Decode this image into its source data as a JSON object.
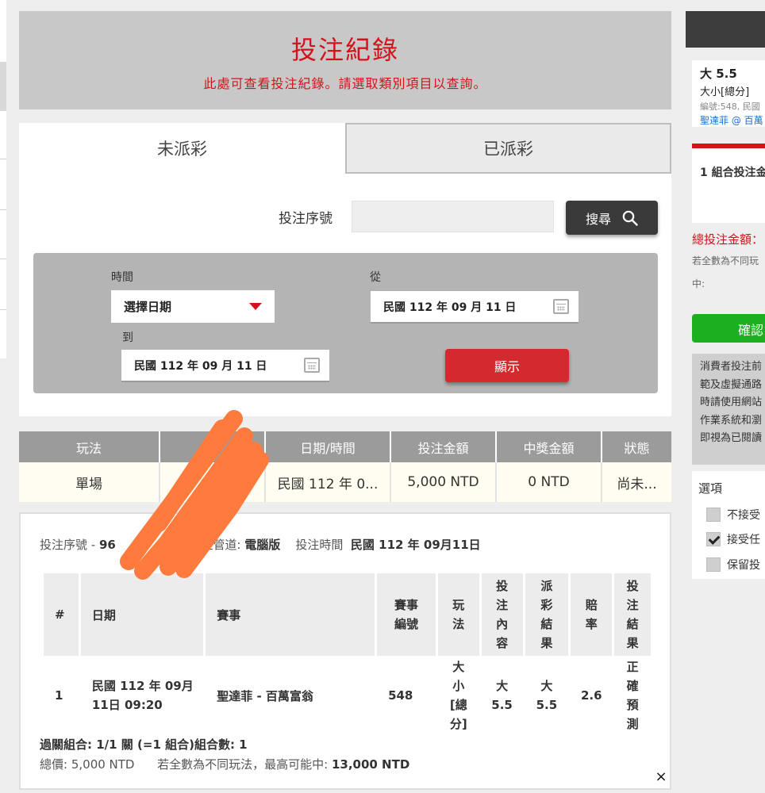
{
  "header": {
    "title": "投注紀錄",
    "subtitle": "此處可查看投注紀錄。請選取類別項目以查詢。"
  },
  "tabs": [
    {
      "label": "未派彩",
      "active": true
    },
    {
      "label": "已派彩",
      "active": false
    }
  ],
  "search": {
    "label": "投注序號",
    "value": "",
    "button_label": "搜尋"
  },
  "filter": {
    "time_label": "時間",
    "time_select_value": "選擇日期",
    "from_label": "從",
    "from_date": "民國 112 年 09 月 11 日",
    "to_label": "到",
    "to_date": "民國 112 年 09 月 11 日",
    "show_button_label": "顯示"
  },
  "results": {
    "headers": [
      "玩法",
      "投",
      "日期/時間",
      "投注金額",
      "中獎金額",
      "狀態"
    ],
    "rows": [
      [
        "單場",
        "",
        "民國 112 年 0...",
        "5,000 NTD",
        "0 NTD",
        "尚未..."
      ]
    ]
  },
  "detail": {
    "serial_label": "投注序號",
    "serial_value": "96",
    "channel_label": "注管道:",
    "channel_value": "電腦版",
    "time_label": "投注時間",
    "time_value": "民國 112 年 09月11日",
    "headers": {
      "num": "#",
      "date": "日期",
      "event": "賽事",
      "event_no": "賽事\n編號",
      "play": "玩\n法",
      "bet_content": "投\n注\n內\n容",
      "payout_result": "派\n彩\n結\n果",
      "odds": "賠\n率",
      "bet_result": "投\n注\n結\n果"
    },
    "row": {
      "num": "1",
      "date": "民國 112 年 09月\n11日 09:20",
      "event": "聖達菲 - 百萬富翁",
      "event_no": "548",
      "play": "大\n小\n[總\n分]",
      "bet_content": "大\n5.5",
      "payout_result": "大\n5.5",
      "odds": "2.6",
      "bet_result": "正\n確\n預\n測"
    },
    "combo_line": "過關組合: 1/1 關 (=1 組合)組合數: 1",
    "total_label": "總價:",
    "total_value": "5,000 NTD",
    "max_label": "若全數為不同玩法，最高可能中:",
    "max_value": "13,000 NTD",
    "close_symbol": "×"
  },
  "slip": {
    "selection_title": "大 5.5",
    "selection_market": "大小[總分]",
    "selection_meta": "編號:548, 民國",
    "selection_match": "聖達菲 @ 百萬",
    "combo_label": "1 組合投注金",
    "total_label": "總投注金額：",
    "note_line1": "若全數為不同玩",
    "note_line2": "中:",
    "confirm_label": "確認",
    "terms": [
      "消費者投注前",
      "範及虛擬通路",
      "時請使用網站",
      "作業系統和瀏",
      "即視為已閱讀"
    ],
    "options_title": "選項",
    "options": [
      {
        "label": "不接受",
        "checked": false
      },
      {
        "label": "接受任",
        "checked": true
      },
      {
        "label": "保留投",
        "checked": false
      }
    ]
  },
  "colors": {
    "accent_red": "#d3131a",
    "confirm_green": "#1bb020",
    "scribble": "#ff7a3d"
  }
}
